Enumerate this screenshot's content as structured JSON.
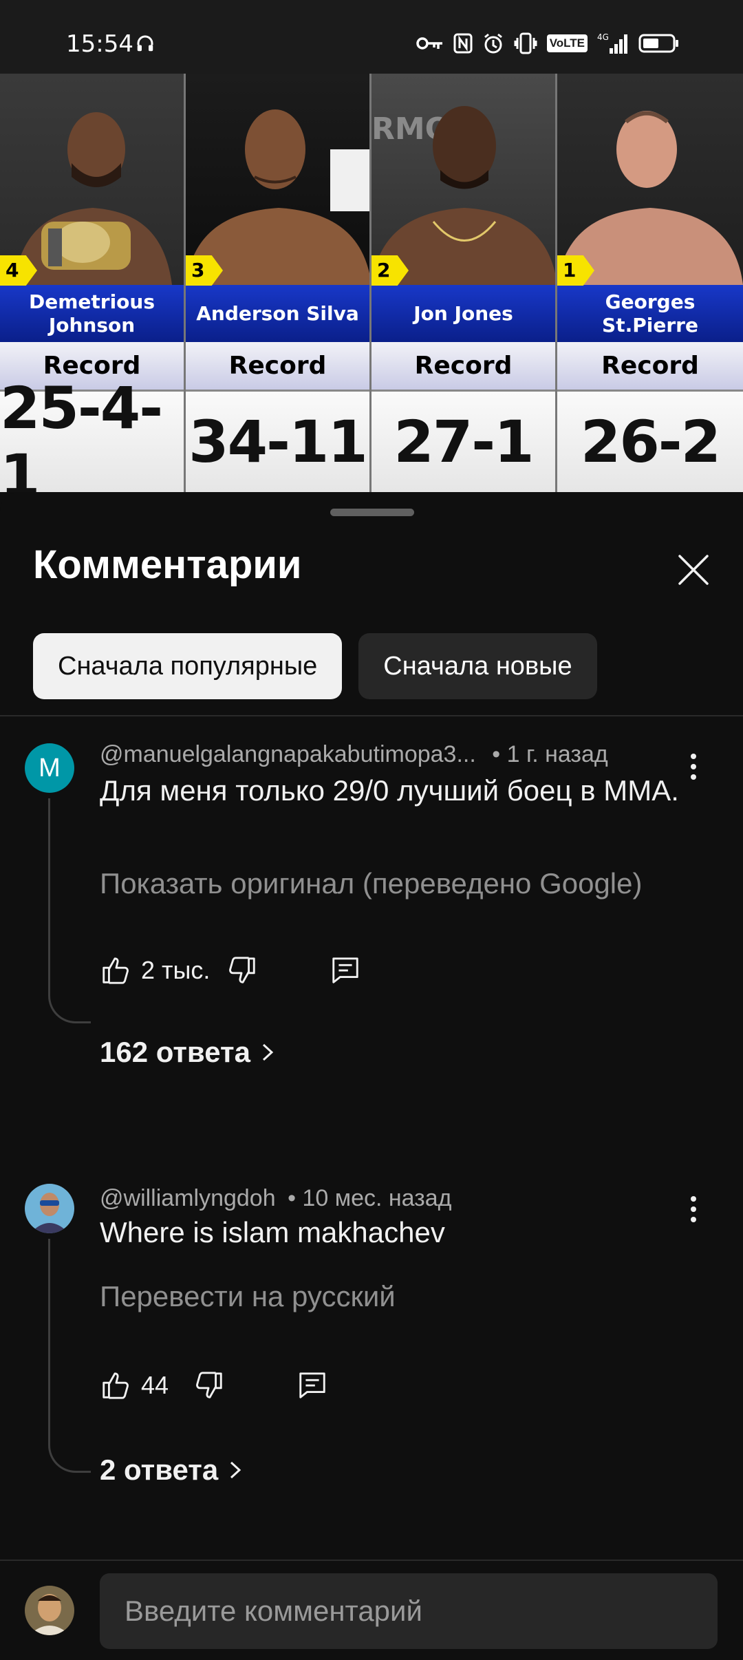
{
  "status_bar": {
    "time": "15:54",
    "icons": [
      "headphones-icon",
      "key-icon",
      "nfc-icon",
      "alarm-icon",
      "vibrate-icon",
      "volte-icon",
      "signal-icon",
      "battery-icon"
    ],
    "volte": "VoLTE",
    "network": "4G"
  },
  "video": {
    "fighters": [
      {
        "rank": "4",
        "name": "Demetrious Johnson",
        "record_label": "Record",
        "record": "25-4-1"
      },
      {
        "rank": "3",
        "name": "Anderson Silva",
        "record_label": "Record",
        "record": "34-11"
      },
      {
        "rank": "2",
        "name": "Jon Jones",
        "record_label": "Record",
        "record": "27-1"
      },
      {
        "rank": "1",
        "name": "Georges St.Pierre",
        "record_label": "Record",
        "record": "26-2"
      }
    ]
  },
  "comments_panel": {
    "title": "Комментарии",
    "sort_chips": [
      {
        "label": "Сначала популярные",
        "active": true
      },
      {
        "label": "Сначала новые",
        "active": false
      }
    ]
  },
  "comments": [
    {
      "avatar_letter": "M",
      "author": "@manuelgalangnapakabutimopa3...",
      "time": "• 1 г. назад",
      "text": "Для меня только 29/0 лучший боец в ММА.",
      "translate_link": "Показать оригинал (переведено Google)",
      "likes": "2 тыс.",
      "replies": "162 ответа"
    },
    {
      "author": "@williamlyngdoh",
      "time": "• 10 мес. назад",
      "text": "Where is islam makhachev",
      "translate_link": "Перевести на русский",
      "likes": "44",
      "replies": "2 ответа"
    }
  ],
  "composer": {
    "placeholder": "Введите комментарий"
  },
  "colors": {
    "background": "#0f0f0f",
    "chip_active": "#f1f1f1",
    "chip_inactive": "#272727",
    "avatar_m": "#0097a7",
    "name_banner": "#1838c8",
    "rank_badge": "#f7e300"
  }
}
